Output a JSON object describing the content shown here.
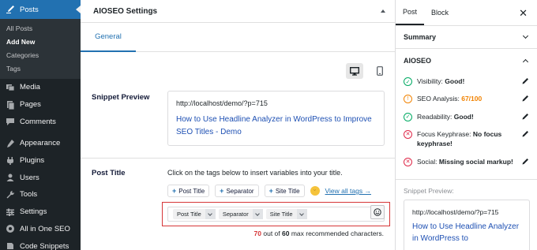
{
  "sidebar": {
    "current": "Posts",
    "sub_items": [
      "All Posts",
      "Add New",
      "Categories",
      "Tags"
    ],
    "items": [
      {
        "label": "Media",
        "icon": "media-icon"
      },
      {
        "label": "Pages",
        "icon": "pages-icon"
      },
      {
        "label": "Comments",
        "icon": "comments-icon"
      },
      {
        "label": "Appearance",
        "icon": "appearance-icon"
      },
      {
        "label": "Plugins",
        "icon": "plugins-icon"
      },
      {
        "label": "Users",
        "icon": "users-icon"
      },
      {
        "label": "Tools",
        "icon": "tools-icon"
      },
      {
        "label": "Settings",
        "icon": "settings-icon"
      },
      {
        "label": "All in One SEO",
        "icon": "aioseo-icon"
      },
      {
        "label": "Code Snippets",
        "icon": "code-snippets-icon"
      }
    ]
  },
  "main": {
    "title": "AIOSEO Settings",
    "tab": "General",
    "snippet_label": "Snippet Preview",
    "snippet_url": "http://localhost/demo/?p=715",
    "snippet_title": "How to Use Headline Analyzer in WordPress to Improve SEO Titles - Demo",
    "post_title_label": "Post Title",
    "post_title_help": "Click on the tags below to insert variables into your title.",
    "tags": [
      "Post Title",
      "Separator",
      "Site Title"
    ],
    "view_all": "View all tags →",
    "title_chips": [
      "Post Title",
      "Separator",
      "Site Title"
    ],
    "char_current": "70",
    "char_middle": " out of ",
    "char_max": "60",
    "char_suffix": " max recommended characters."
  },
  "side": {
    "tabs": [
      "Post",
      "Block"
    ],
    "summary": "Summary",
    "aioseo": "AIOSEO",
    "checks": [
      {
        "label": "Visibility: ",
        "value": "Good!",
        "status": "good"
      },
      {
        "label": "SEO Analysis: ",
        "value": "67/100",
        "status": "warn"
      },
      {
        "label": "Readability: ",
        "value": "Good!",
        "status": "good"
      },
      {
        "label": "Focus Keyphrase: ",
        "value": "No focus keyphrase!",
        "status": "bad"
      },
      {
        "label": "Social: ",
        "value": "Missing social markup!",
        "status": "bad"
      }
    ],
    "snippet_label": "Snippet Preview:",
    "snippet_url": "http://localhost/demo/?p=715",
    "snippet_title": "How to Use Headline Analyzer in WordPress to"
  },
  "colors": {
    "wp_blue": "#2271b1",
    "sidebar_bg": "#1d2327",
    "good": "#00aa63",
    "warn": "#f18200",
    "bad": "#df2a4a",
    "error_outline": "#d63638"
  }
}
